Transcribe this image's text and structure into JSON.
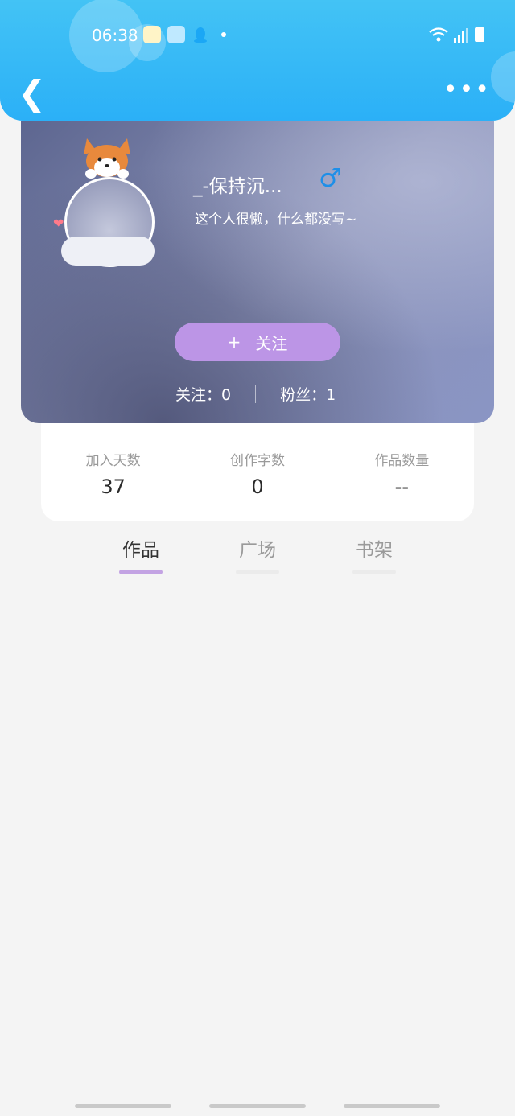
{
  "status_bar": {
    "time": "06:38"
  },
  "profile": {
    "username": "_-保持沉...",
    "gender_symbol": "♂",
    "bio": "这个人很懒，什么都没写~",
    "follow_label": "关注",
    "follow_icon": "+",
    "following_label": "关注：0",
    "fans_label": "粉丝：1"
  },
  "stats": [
    {
      "label": "加入天数",
      "value": "37"
    },
    {
      "label": "创作字数",
      "value": "0"
    },
    {
      "label": "作品数量",
      "value": "--"
    }
  ],
  "tabs": [
    {
      "label": "作品",
      "active": true
    },
    {
      "label": "广场",
      "active": false
    },
    {
      "label": "书架",
      "active": false
    }
  ],
  "colors": {
    "header": "#2bb0f7",
    "accent": "#bc95e6",
    "gender": "#1e8fe8"
  }
}
